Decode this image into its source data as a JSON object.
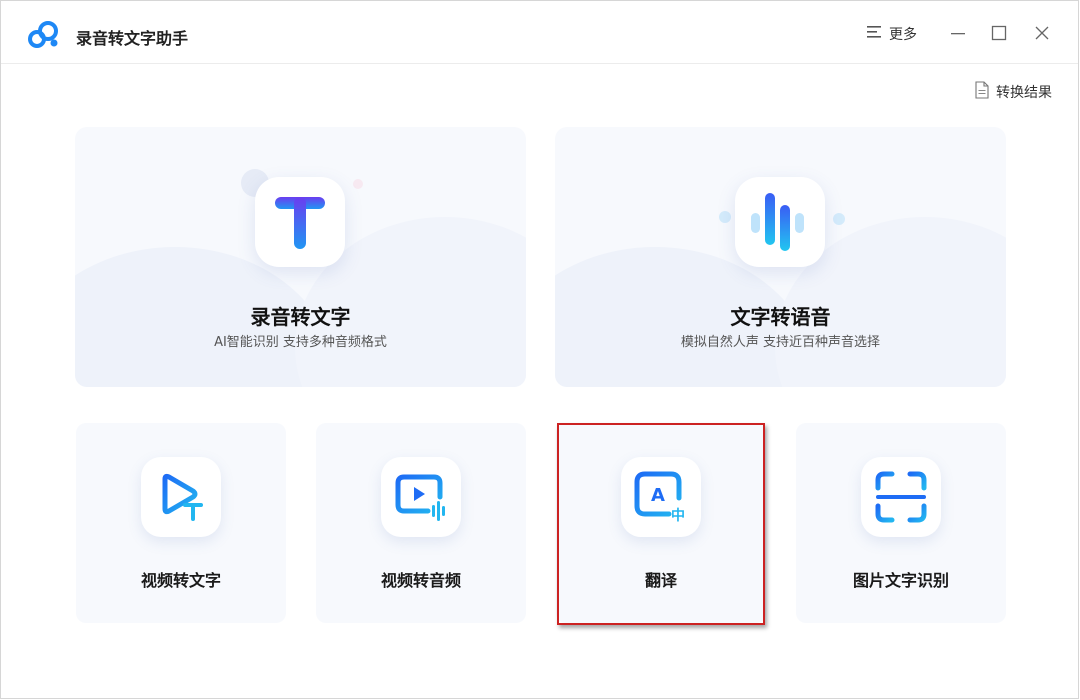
{
  "app": {
    "title": "录音转文字助手",
    "logo": "cloud-logo-icon"
  },
  "titlebar": {
    "more_label": "更多",
    "more_icon": "menu-lines-icon",
    "minimize_icon": "minimize-icon",
    "maximize_icon": "maximize-icon",
    "close_icon": "close-icon"
  },
  "toolbar": {
    "result_label": "转换结果",
    "result_icon": "document-icon"
  },
  "big_cards": [
    {
      "title": "录音转文字",
      "subtitle": "AI智能识别 支持多种音频格式",
      "icon": "letter-t-icon"
    },
    {
      "title": "文字转语音",
      "subtitle": "模拟自然人声 支持近百种声音选择",
      "icon": "sound-wave-icon"
    }
  ],
  "small_cards": [
    {
      "title": "视频转文字",
      "icon": "video-to-text-icon"
    },
    {
      "title": "视频转音频",
      "icon": "video-to-audio-icon"
    },
    {
      "title": "翻译",
      "icon": "translate-icon",
      "highlighted": true
    },
    {
      "title": "图片文字识别",
      "icon": "scan-image-icon"
    }
  ],
  "colors": {
    "accent": "#1e88f5",
    "highlight_border": "#cc2222",
    "card_bg": "#f7f9fd"
  }
}
